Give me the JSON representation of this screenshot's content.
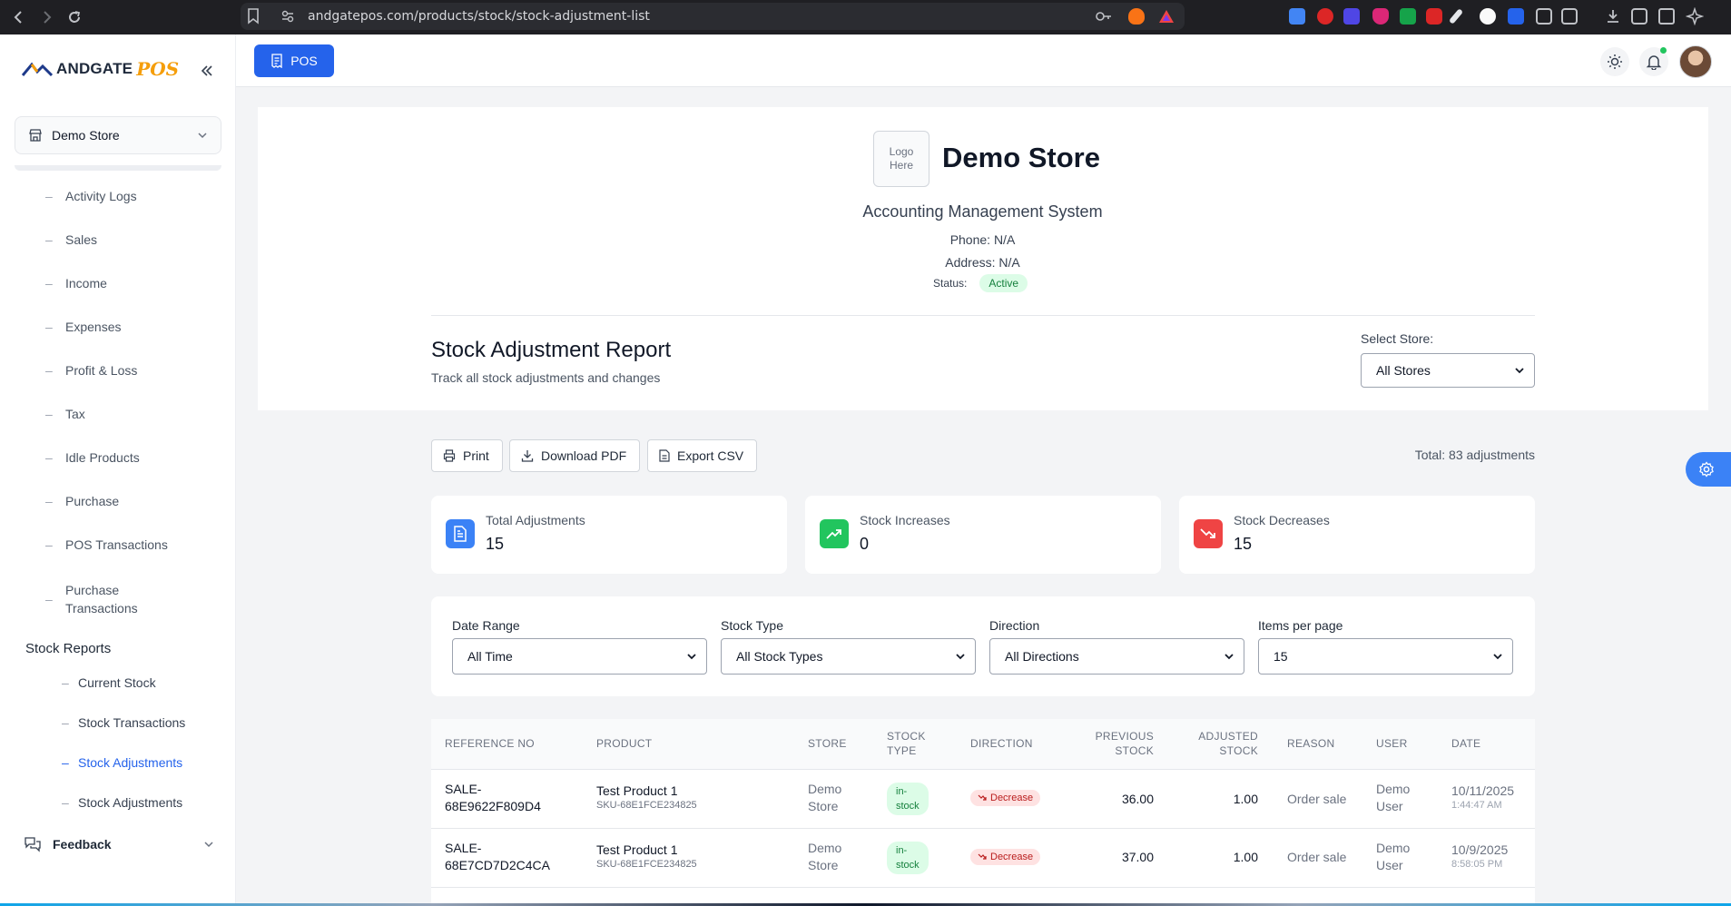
{
  "browser": {
    "url": "andgatepos.com/products/stock/stock-adjustment-list"
  },
  "sidebar": {
    "logo_text": "ANDGATE",
    "logo_accent": "POS",
    "store_selector": "Demo Store",
    "nav_items": [
      {
        "label": "Activity Logs"
      },
      {
        "label": "Sales"
      },
      {
        "label": "Income"
      },
      {
        "label": "Expenses"
      },
      {
        "label": "Profit & Loss"
      },
      {
        "label": "Tax"
      },
      {
        "label": "Idle Products"
      },
      {
        "label": "Purchase"
      },
      {
        "label": "POS Transactions"
      },
      {
        "label": "Purchase Transactions"
      }
    ],
    "stock_reports_heading": "Stock Reports",
    "stock_reports_items": [
      {
        "label": "Current Stock",
        "active": false
      },
      {
        "label": "Stock Transactions",
        "active": false
      },
      {
        "label": "Stock Adjustments",
        "active": true
      },
      {
        "label": "Stock Adjustments",
        "active": false
      }
    ],
    "feedback_label": "Feedback"
  },
  "header": {
    "pos_button": "POS"
  },
  "store_header": {
    "logo_placeholder": "Logo Here",
    "store_name": "Demo Store",
    "subtitle": "Accounting Management System",
    "phone": "Phone: N/A",
    "address": "Address: N/A",
    "status_label": "Status:",
    "status_value": "Active"
  },
  "report": {
    "title": "Stock Adjustment Report",
    "description": "Track all stock adjustments and changes",
    "select_store_label": "Select Store:",
    "select_store_value": "All Stores"
  },
  "actions": {
    "print": "Print",
    "download_pdf": "Download PDF",
    "export_csv": "Export CSV",
    "total": "Total: 83 adjustments"
  },
  "stats": [
    {
      "label": "Total Adjustments",
      "value": "15",
      "color": "#3b82f6"
    },
    {
      "label": "Stock Increases",
      "value": "0",
      "color": "#22c55e"
    },
    {
      "label": "Stock Decreases",
      "value": "15",
      "color": "#ef4444"
    }
  ],
  "filters": [
    {
      "label": "Date Range",
      "value": "All Time"
    },
    {
      "label": "Stock Type",
      "value": "All Stock Types"
    },
    {
      "label": "Direction",
      "value": "All Directions"
    },
    {
      "label": "Items per page",
      "value": "15"
    }
  ],
  "table": {
    "headers": {
      "reference": "REFERENCE NO",
      "product": "PRODUCT",
      "store": "STORE",
      "stock_type_1": "STOCK",
      "stock_type_2": "TYPE",
      "direction": "DIRECTION",
      "previous_1": "PREVIOUS",
      "previous_2": "STOCK",
      "adjusted_1": "ADJUSTED",
      "adjusted_2": "STOCK",
      "reason": "REASON",
      "user": "USER",
      "date": "DATE"
    },
    "rows": [
      {
        "ref_1": "SALE-",
        "ref_2": "68E9622F809D4",
        "product": "Test Product 1",
        "sku": "SKU-68E1FCE234825",
        "store_1": "Demo",
        "store_2": "Store",
        "stock_type_1": "in-",
        "stock_type_2": "stock",
        "direction": "Decrease",
        "previous": "36.00",
        "adjusted": "1.00",
        "reason": "Order sale",
        "user_1": "Demo",
        "user_2": "User",
        "date": "10/11/2025",
        "time": "1:44:47 AM"
      },
      {
        "ref_1": "SALE-",
        "ref_2": "68E7CD7D2C4CA",
        "product": "Test Product 1",
        "sku": "SKU-68E1FCE234825",
        "store_1": "Demo",
        "store_2": "Store",
        "stock_type_1": "in-",
        "stock_type_2": "stock",
        "direction": "Decrease",
        "previous": "37.00",
        "adjusted": "1.00",
        "reason": "Order sale",
        "user_1": "Demo",
        "user_2": "User",
        "date": "10/9/2025",
        "time": "8:58:05 PM"
      }
    ]
  }
}
